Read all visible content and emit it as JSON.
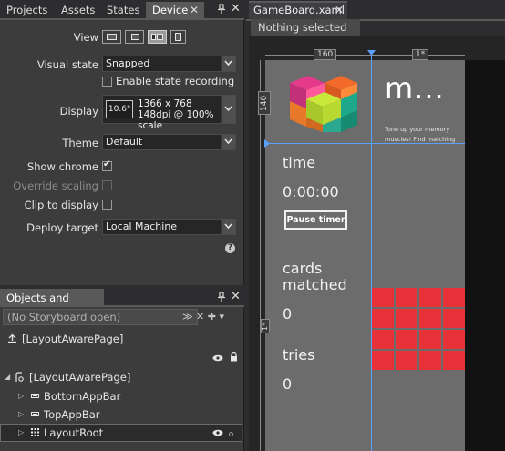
{
  "device_panel": {
    "tabs": [
      {
        "label": "Projects"
      },
      {
        "label": "Assets"
      },
      {
        "label": "States"
      },
      {
        "label": "Device",
        "active": true
      }
    ],
    "close_glyph": "✕",
    "view_label": "View",
    "view_buttons": [
      "landscape-full",
      "landscape-filled",
      "landscape-snapped",
      "portrait"
    ],
    "active_view": "landscape-snapped",
    "visual_state": {
      "label": "Visual state",
      "value": "Snapped"
    },
    "enable_state_recording": {
      "label": "Enable state recording",
      "checked": false
    },
    "display": {
      "label": "Display",
      "size": "10.6\"",
      "resolution": "1366 x 768",
      "dpi": "148dpi @ 100% scale"
    },
    "theme": {
      "label": "Theme",
      "value": "Default"
    },
    "show_chrome": {
      "label": "Show chrome",
      "checked": true
    },
    "override_scaling": {
      "label": "Override scaling",
      "checked": false,
      "disabled": true
    },
    "clip_to_display": {
      "label": "Clip to display",
      "checked": false
    },
    "deploy_target": {
      "label": "Deploy target",
      "value": "Local Machine"
    },
    "help_glyph": "?"
  },
  "objects_panel": {
    "title": "Objects and Timeline",
    "storyboard_placeholder": "(No Storyboard open)",
    "storyboard_icons": "≫ ✕  ✚ ▾",
    "tree": [
      {
        "label": "[LayoutAwarePage]",
        "icon": "up-arrow-icon",
        "level": 0
      },
      {
        "label": "[LayoutAwarePage]",
        "icon": "page-icon",
        "level": 0,
        "expanded": true
      },
      {
        "label": "BottomAppBar",
        "icon": "appbar-icon",
        "level": 1
      },
      {
        "label": "TopAppBar",
        "icon": "appbar-icon",
        "level": 1
      },
      {
        "label": "LayoutRoot",
        "icon": "grid-icon",
        "level": 1,
        "selected": true
      }
    ]
  },
  "designer": {
    "tab": "GameBoard.xaml",
    "selection_status": "Nothing selected",
    "ruler": {
      "col1": "160",
      "col2": "1*",
      "row1": "140",
      "row2": "1*"
    },
    "app": {
      "title": "m...",
      "subtitle": "Tone up your memory muscles! Find matching",
      "time_label": "time",
      "time_value": "0:00:00",
      "pause_label": "Pause timer",
      "cards_label_1": "cards",
      "cards_label_2": "matched",
      "cards_value": "0",
      "tries_label": "tries",
      "tries_value": "0",
      "card_grid": {
        "rows": 4,
        "cols": 4,
        "color": "#e8323a"
      }
    }
  },
  "colors": {
    "accent_guide": "#5aa0ff",
    "panel_bg": "#3c3c3c",
    "app_bg": "#6c6c6c"
  }
}
